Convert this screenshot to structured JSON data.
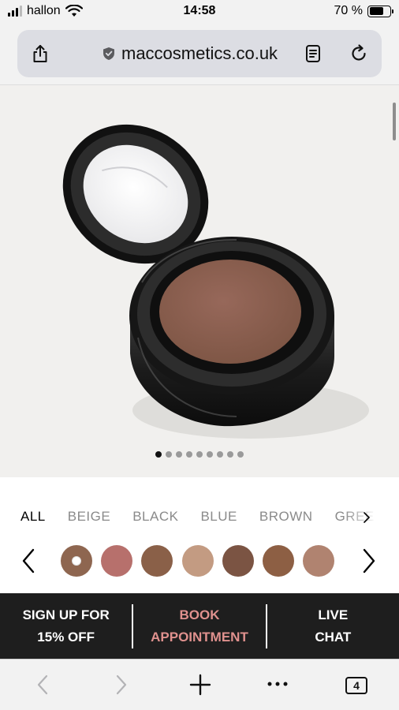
{
  "status_bar": {
    "carrier": "hallon",
    "time": "14:58",
    "battery_text": "70 %",
    "battery_level": 0.7
  },
  "browser": {
    "domain": "maccosmetics.co.uk",
    "tab_count": "4"
  },
  "product": {
    "image_dots_total": 9,
    "image_dots_active": 0,
    "pan_color": "#8a5d48"
  },
  "filters": {
    "tabs": [
      "ALL",
      "BEIGE",
      "BLACK",
      "BLUE",
      "BROWN",
      "GREE"
    ],
    "active_tab": "ALL"
  },
  "swatches": [
    {
      "color": "#8e6650",
      "selected": true
    },
    {
      "color": "#b7706c",
      "selected": false
    },
    {
      "color": "#8a6048",
      "selected": false
    },
    {
      "color": "#c39b82",
      "selected": false
    },
    {
      "color": "#7b5443",
      "selected": false
    },
    {
      "color": "#8d5f44",
      "selected": false
    },
    {
      "color": "#b08370",
      "selected": false
    }
  ],
  "cta": {
    "signup_line1": "SIGN UP FOR",
    "signup_line2": "15% OFF",
    "book_line1": "BOOK",
    "book_line2": "APPOINTMENT",
    "chat_line1": "LIVE",
    "chat_line2": "CHAT",
    "accent_color": "#e0918e"
  },
  "icons": {
    "share": "share-icon",
    "shield": "shield-icon",
    "reader": "reader-icon",
    "reload": "reload-icon",
    "back": "back-icon",
    "forward": "forward-icon",
    "new_tab": "plus-icon",
    "more": "more-icon",
    "tabs": "tabs-icon"
  }
}
